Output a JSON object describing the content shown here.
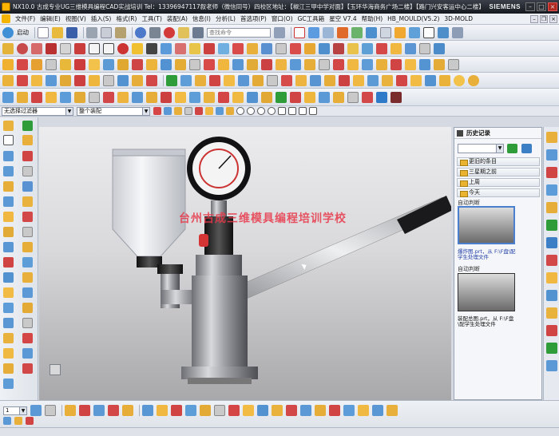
{
  "window": {
    "title": "NX10.0 古成专业UG三维模具编程CAD实战培训  Tel：13396947117叙老师（微信同号）四校区地址：【椒江三甲中学对面】【玉环华海商务广场二楼】【路门兴安客运中心二楼】",
    "brand": "SIEMENS"
  },
  "menu": {
    "items": [
      "文件(F)",
      "编辑(E)",
      "视图(V)",
      "插入(S)",
      "格式(R)",
      "工具(T)",
      "装配(A)",
      "信息(I)",
      "分析(L)",
      "首选项(P)",
      "窗口(O)",
      "GC工具箱",
      "星空 V7.4",
      "帮助(H)",
      "HB_MOULD(V5.2)",
      "3D-MOLD"
    ]
  },
  "toolbar": {
    "start_label": "启动",
    "command_placeholder": "查找命令"
  },
  "filter": {
    "selection_filter": "无选择过滤器",
    "assembly_scope": "整个装配"
  },
  "viewport": {
    "watermark": "台州古成三维模具编程培训学校"
  },
  "history": {
    "title": "历史记录",
    "groups": [
      "更旧的条目",
      "三星期之前",
      "上周",
      "今天"
    ],
    "entries": [
      {
        "section": "自动判断",
        "caption": "爆炸图.prt，从 F:\\F盘\\配学生处理文件"
      },
      {
        "section": "自动判断",
        "caption": "装配总图.prt，从 F:\\F盘\\配学生处理文件"
      }
    ]
  },
  "bottom": {
    "layer_value": "1"
  },
  "colors": {
    "titlebar": "#1e2229",
    "watermark": "#e8394a",
    "selection": "#4a7fd0",
    "folder": "#e9b330"
  }
}
